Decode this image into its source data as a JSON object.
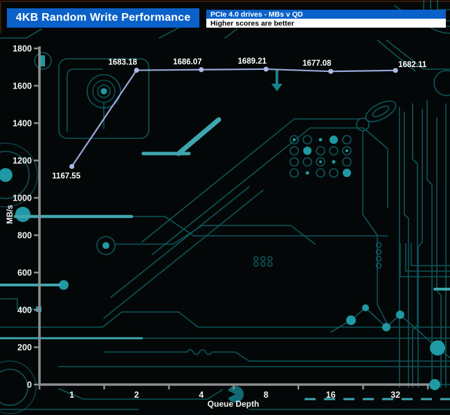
{
  "header": {
    "title": "4KB Random Write Performance",
    "subtitle_top": "PCIe 4.0 drives - MBs v QD",
    "subtitle_bottom": "Higher scores are better"
  },
  "chart_data": {
    "type": "line",
    "title": "4KB Random Write Performance",
    "subtitle": "PCIe 4.0 drives - MBs v QD",
    "note": "Higher scores are better",
    "categories": [
      "1",
      "2",
      "4",
      "8",
      "16",
      "32"
    ],
    "values": [
      1167.55,
      1683.18,
      1686.07,
      1689.21,
      1677.08,
      1682.11
    ],
    "point_labels": [
      "1167.55",
      "1683.18",
      "1686.07",
      "1689.21",
      "1677.08",
      "1682.11"
    ],
    "xlabel": "Queue Depth",
    "ylabel": "MB/s",
    "ylim": [
      0,
      1800
    ],
    "yticks": [
      0,
      200,
      400,
      600,
      800,
      1000,
      1200,
      1400,
      1600,
      1800
    ],
    "grid": false,
    "legend": "none",
    "colors": {
      "line": "#98a8db",
      "marker": "#aeb9e8",
      "axis": "#8f8f8f",
      "tick_text": "#f2f2f2",
      "data_label_text": "#ffffff",
      "background": "#040707",
      "circuit_trace": "#0d565c",
      "circuit_pad": "#1f99a4",
      "header_blue": "#0a61c9"
    }
  }
}
